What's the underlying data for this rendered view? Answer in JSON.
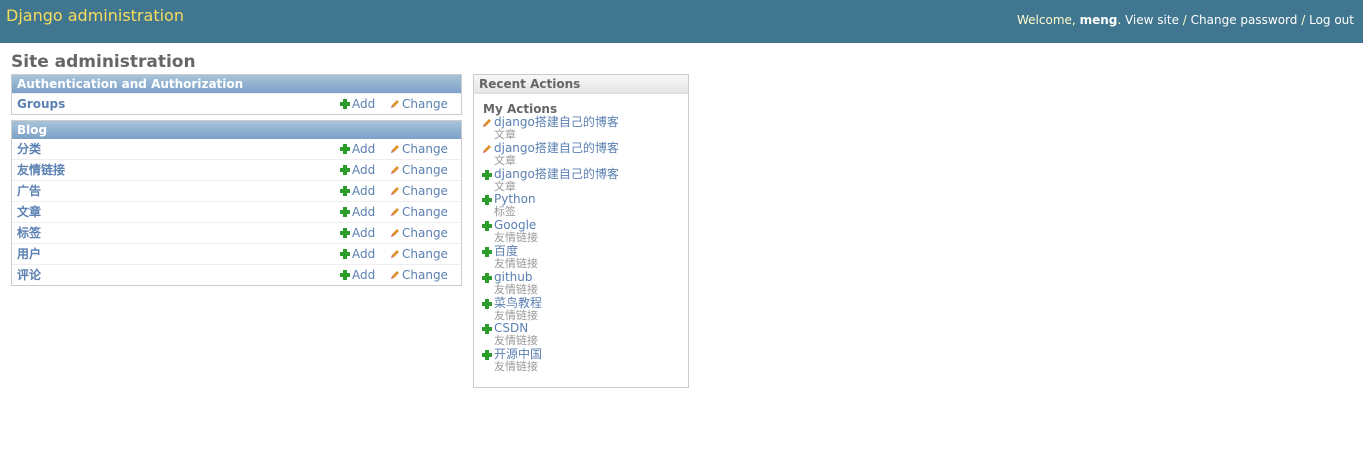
{
  "header": {
    "branding": "Django administration",
    "welcome": "Welcome,",
    "username": "meng",
    "view_site": "View site",
    "change_password": "Change password",
    "log_out": "Log out",
    "sep": "/"
  },
  "page_title": "Site administration",
  "apps": [
    {
      "caption": "Authentication and Authorization",
      "models": [
        {
          "name": "Groups"
        }
      ]
    },
    {
      "caption": "Blog",
      "models": [
        {
          "name": "分类"
        },
        {
          "name": "友情链接"
        },
        {
          "name": "广告"
        },
        {
          "name": "文章"
        },
        {
          "name": "标签"
        },
        {
          "name": "用户"
        },
        {
          "name": "评论"
        }
      ]
    }
  ],
  "labels": {
    "add": "Add",
    "change": "Change"
  },
  "recent": {
    "caption": "Recent Actions",
    "subtitle": "My Actions",
    "items": [
      {
        "icon": "pencil-icon",
        "title": "django搭建自己的博客",
        "type": "文章"
      },
      {
        "icon": "pencil-icon",
        "title": "django搭建自己的博客",
        "type": "文章"
      },
      {
        "icon": "plus-icon",
        "title": "django搭建自己的博客",
        "type": "文章"
      },
      {
        "icon": "plus-icon",
        "title": "Python",
        "type": "标签"
      },
      {
        "icon": "plus-icon",
        "title": "Google",
        "type": "友情链接"
      },
      {
        "icon": "plus-icon",
        "title": "百度",
        "type": "友情链接"
      },
      {
        "icon": "plus-icon",
        "title": "github",
        "type": "友情链接"
      },
      {
        "icon": "plus-icon",
        "title": "菜鸟教程",
        "type": "友情链接"
      },
      {
        "icon": "plus-icon",
        "title": "CSDN",
        "type": "友情链接"
      },
      {
        "icon": "plus-icon",
        "title": "开源中国",
        "type": "友情链接"
      }
    ]
  },
  "colors": {
    "header_bg": "#417690",
    "branding": "#f5dd5d",
    "link": "#5b80b2",
    "add_green": "#2a9d2a",
    "change_pencil": "#e0922f"
  }
}
